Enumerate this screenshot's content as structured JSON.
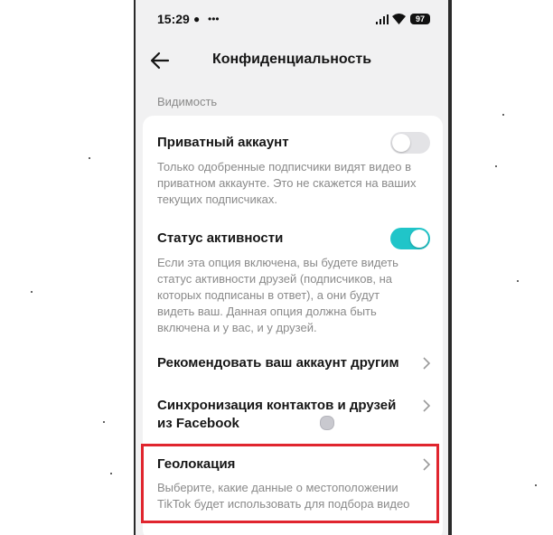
{
  "status_bar": {
    "time": "15:29",
    "battery": "97"
  },
  "header": {
    "title": "Конфиденциальность"
  },
  "section": {
    "label": "Видимость"
  },
  "settings": {
    "private_account": {
      "title": "Приватный аккаунт",
      "description": "Только одобренные подписчики видят видео в приватном аккаунте. Это не скажется на ваших текущих подписчиках.",
      "enabled": false
    },
    "activity_status": {
      "title": "Статус активности",
      "description": "Если эта опция включена, вы будете видеть статус активности друзей (подписчиков, на которых подписаны в ответ), а они будут видеть ваш. Данная опция должна быть включена и у вас, и у друзей.",
      "enabled": true
    },
    "recommend_account": {
      "title": "Рекомендовать ваш аккаунт другим"
    },
    "sync_contacts": {
      "title": "Синхронизация контактов и друзей из Facebook"
    },
    "geolocation": {
      "title": "Геолокация",
      "description": "Выберите, какие данные о местоположении TikTok будет использовать для подбора видео"
    }
  },
  "colors": {
    "toggle_on": "#20c5c9",
    "toggle_off": "#e3e3e6",
    "highlight": "#e0252e"
  }
}
